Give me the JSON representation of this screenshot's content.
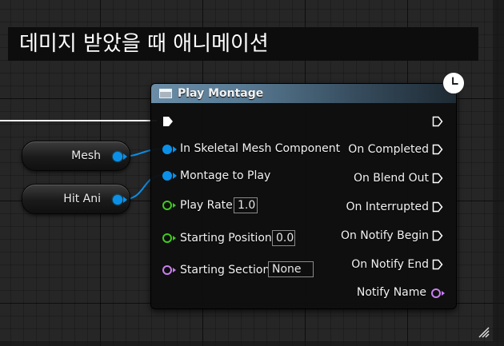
{
  "comment": {
    "title": "데미지 받았을 때 애니메이션"
  },
  "variables": [
    {
      "label": "Mesh"
    },
    {
      "label": "Hit Ani"
    }
  ],
  "node": {
    "title": "Play Montage",
    "inputs": [
      {
        "label": "In Skeletal Mesh Component",
        "type": "object"
      },
      {
        "label": "Montage to Play",
        "type": "object"
      },
      {
        "label": "Play Rate",
        "type": "float",
        "value": "1.0"
      },
      {
        "label": "Starting Position",
        "type": "float",
        "value": "0.0"
      },
      {
        "label": "Starting Section",
        "type": "name",
        "value": "None"
      }
    ],
    "outputs": [
      {
        "label": "On Completed",
        "type": "exec"
      },
      {
        "label": "On Blend Out",
        "type": "exec"
      },
      {
        "label": "On Interrupted",
        "type": "exec"
      },
      {
        "label": "On Notify Begin",
        "type": "exec"
      },
      {
        "label": "On Notify End",
        "type": "exec"
      },
      {
        "label": "Notify Name",
        "type": "name"
      }
    ]
  },
  "colors": {
    "object_pin": "#0b90e8",
    "float_pin": "#3fcc1e",
    "name_pin": "#c97ff0",
    "exec_pin": "#ffffff"
  }
}
